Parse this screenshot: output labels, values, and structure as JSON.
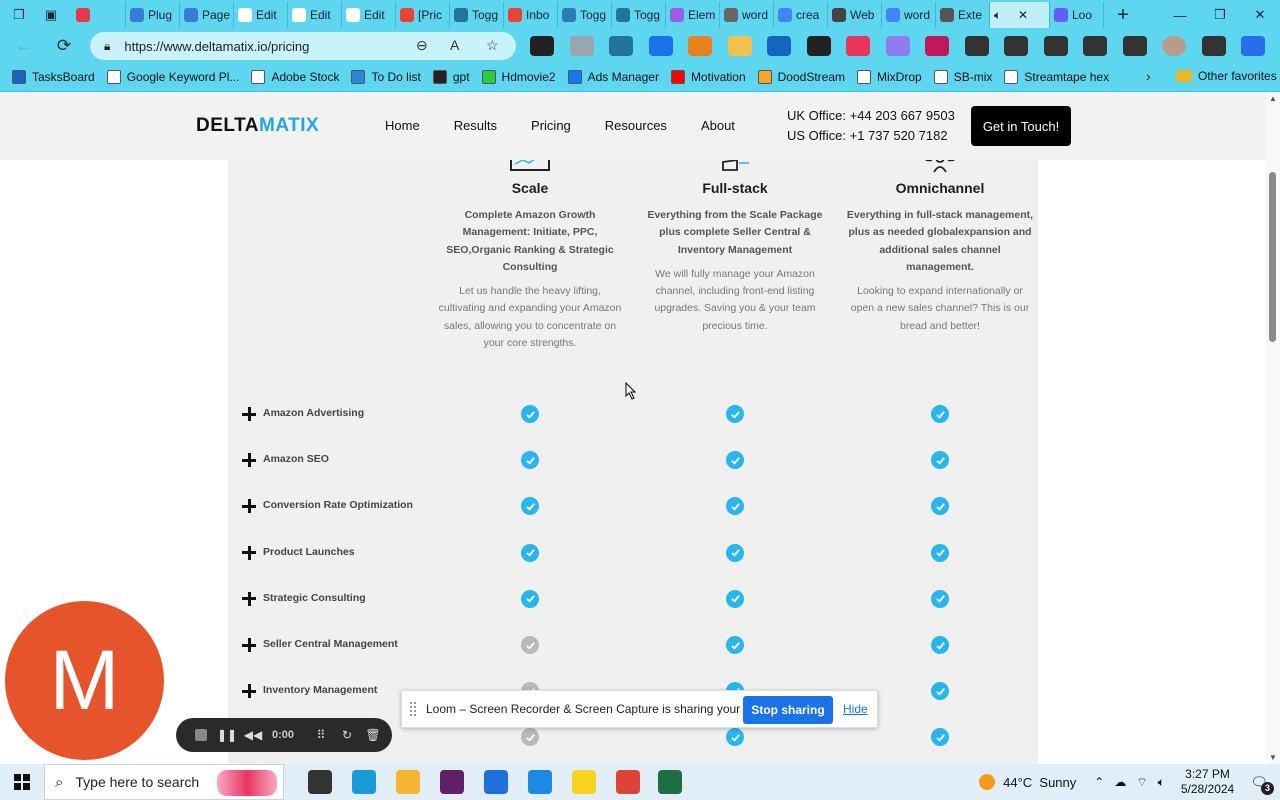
{
  "browser": {
    "tabs": [
      {
        "label": "",
        "color": "#e33b4b"
      },
      {
        "label": "Plug",
        "color": "#3a7bd5"
      },
      {
        "label": "Page",
        "color": "#3a7bd5"
      },
      {
        "label": "Edit",
        "color": "#ffffff"
      },
      {
        "label": "Edit",
        "color": "#ffffff"
      },
      {
        "label": "Edit",
        "color": "#ffffff"
      },
      {
        "label": "[Pric",
        "color": "#ea4335"
      },
      {
        "label": "Togg",
        "color": "#21759b"
      },
      {
        "label": "Inbo",
        "color": "#ea4335"
      },
      {
        "label": "Togg",
        "color": "#2c7ab6"
      },
      {
        "label": "Togg",
        "color": "#21759b"
      },
      {
        "label": "Elem",
        "color": "#9b5de5"
      },
      {
        "label": "word",
        "color": "#666666"
      },
      {
        "label": "crea",
        "color": "#4285f4"
      },
      {
        "label": "Web",
        "color": "#444444"
      },
      {
        "label": "word",
        "color": "#4285f4"
      },
      {
        "label": "Exte",
        "color": "#555555"
      },
      {
        "label": "",
        "color": "#5ed6f0",
        "active": true
      },
      {
        "label": "Loo",
        "color": "#625df5"
      }
    ],
    "url": "https://www.deltamatix.io/pricing",
    "extensions": [
      {
        "name": "extension-icon",
        "color": "#222222"
      },
      {
        "name": "shield-icon",
        "color": "#9aa6ad"
      },
      {
        "name": "wordpress-icon",
        "color": "#21759b"
      },
      {
        "name": "k-icon",
        "color": "#1a73e8"
      },
      {
        "name": "fox-icon",
        "color": "#e8821e"
      },
      {
        "name": "pencil-icon",
        "color": "#f2c14e"
      },
      {
        "name": "grid-icon",
        "color": "#1565c0"
      },
      {
        "name": "eyedropper-icon",
        "color": "#222222"
      },
      {
        "name": "color-wheel-icon",
        "color": "#e8365d"
      },
      {
        "name": "cloud-icon",
        "color": "#8e7cf0"
      },
      {
        "name": "gear-badge-icon",
        "color": "#c2185b"
      },
      {
        "name": "puzzle-icon",
        "color": "#333333"
      },
      {
        "name": "split-screen-icon",
        "color": "#333333"
      },
      {
        "name": "favorites-icon",
        "color": "#333333"
      },
      {
        "name": "collections-icon",
        "color": "#333333"
      },
      {
        "name": "performance-icon",
        "color": "#333333"
      },
      {
        "name": "profile-icon",
        "color": "#b89b8a"
      },
      {
        "name": "more-icon",
        "color": "#333333"
      },
      {
        "name": "copilot-icon",
        "color": "#2b6de8"
      }
    ],
    "bookmarks": [
      {
        "label": "TasksBoard",
        "color": "#1565c0"
      },
      {
        "label": "Google Keyword Pl...",
        "color": "#ffffff"
      },
      {
        "label": "Adobe Stock",
        "color": "#ffffff"
      },
      {
        "label": "To Do list",
        "color": "#2b88d8"
      },
      {
        "label": "gpt",
        "color": "#222222"
      },
      {
        "label": "Hdmovie2",
        "color": "#2ecc40"
      },
      {
        "label": "Ads Manager",
        "color": "#1877f2"
      },
      {
        "label": "Motivation",
        "color": "#ff0000"
      },
      {
        "label": "DoodStream",
        "color": "#f5a623"
      },
      {
        "label": "MixDrop",
        "color": "#ffffff"
      },
      {
        "label": "SB-mix",
        "color": "#ffffff"
      },
      {
        "label": "Streamtape hex",
        "color": "#ffffff"
      }
    ],
    "other_favorites": "Other favorites"
  },
  "site": {
    "logo_a": "DELTA",
    "logo_b": "MATIX",
    "nav": [
      "Home",
      "Results",
      "Pricing",
      "Resources",
      "About"
    ],
    "uk_office": "UK Office: +44 203 667 9503",
    "us_office": "US Office: +1 737 520 7182",
    "cta": "Get in Touch!"
  },
  "plans": [
    {
      "name": "Scale",
      "subtitle": "Complete Amazon Growth Management: Initiate, PPC, SEO,Organic Ranking & Strategic Consulting",
      "description": "Let us handle the heavy lifting, cultivating and expanding your Amazon sales, allowing you to concentrate on your core strengths."
    },
    {
      "name": "Full-stack",
      "subtitle": "Everything from the Scale Package plus complete Seller Central & Inventory Management",
      "description": "We will fully manage your Amazon channel, including front-end listing upgrades. Saving you & your team precious time."
    },
    {
      "name": "Omnichannel",
      "subtitle": "Everything in full-stack management, plus as needed globalexpansion and additional sales channel management.",
      "description": "Looking to expand internationally or open a new sales channel? This is our bread and better!"
    }
  ],
  "features": [
    {
      "name": "Amazon Advertising",
      "included": [
        true,
        true,
        true
      ]
    },
    {
      "name": "Amazon SEO",
      "included": [
        true,
        true,
        true
      ]
    },
    {
      "name": "Conversion Rate Optimization",
      "included": [
        true,
        true,
        true
      ]
    },
    {
      "name": "Product Launches",
      "included": [
        true,
        true,
        true
      ]
    },
    {
      "name": "Strategic Consulting",
      "included": [
        true,
        true,
        true
      ]
    },
    {
      "name": "Seller Central Management",
      "included": [
        false,
        true,
        true
      ]
    },
    {
      "name": "Inventory Management",
      "included": [
        false,
        true,
        true
      ]
    },
    {
      "name": "",
      "included": [
        false,
        true,
        true
      ]
    }
  ],
  "loom": {
    "avatar_letter": "M",
    "timer": "0:00",
    "message": "Loom – Screen Recorder & Screen Capture is sharing your screen.",
    "stop": "Stop sharing",
    "hide": "Hide"
  },
  "taskbar": {
    "search_placeholder": "Type here to search",
    "apps": [
      {
        "name": "task-view-icon",
        "color": "#333333"
      },
      {
        "name": "edge-icon",
        "color": "#1a9bd8"
      },
      {
        "name": "file-explorer-icon",
        "color": "#f2b632"
      },
      {
        "name": "slack-icon",
        "color": "#611f69"
      },
      {
        "name": "store-icon",
        "color": "#1e6fd9"
      },
      {
        "name": "mail-icon",
        "color": "#1e88e5"
      },
      {
        "name": "sticky-notes-icon",
        "color": "#f7d21e"
      },
      {
        "name": "chrome-icon",
        "color": "#db4437"
      },
      {
        "name": "excel-icon",
        "color": "#1d6f42"
      }
    ],
    "temperature": "44°C",
    "weather": "Sunny",
    "time": "3:27 PM",
    "date": "5/28/2024",
    "notifications": "3"
  }
}
